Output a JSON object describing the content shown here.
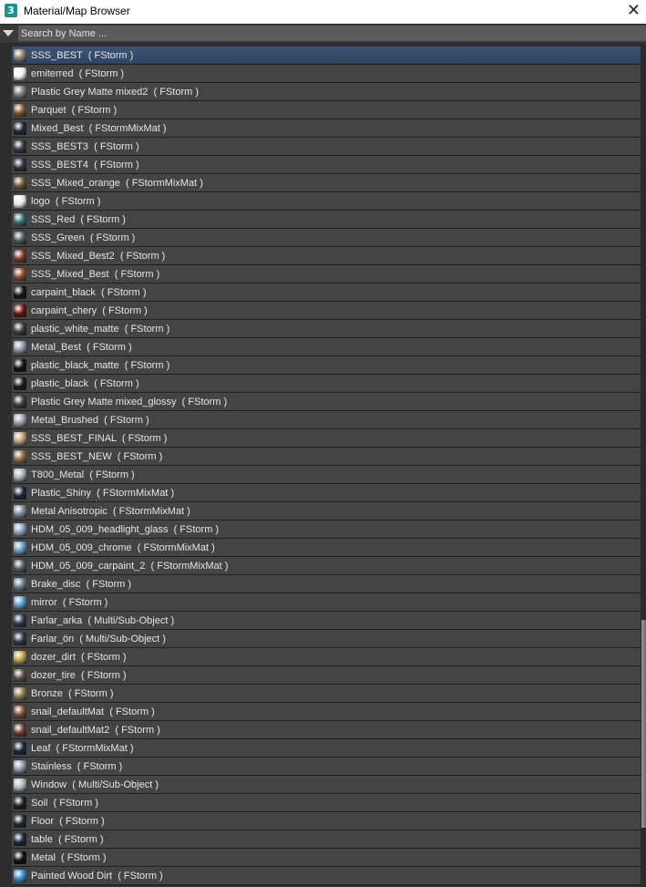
{
  "window": {
    "title": "Material/Map Browser",
    "app_icon": "3",
    "close_icon": "close-icon"
  },
  "search": {
    "placeholder": "Search by Name ..."
  },
  "scrollbar": {
    "position_fraction": 0.68
  },
  "materials": [
    {
      "name": "SSS_BEST",
      "type": "FStorm",
      "color": "#8a7a68",
      "selected": true
    },
    {
      "name": "emiterred",
      "type": "FStorm",
      "color": "#f4f0ee"
    },
    {
      "name": "Plastic Grey Matte mixed2",
      "type": "FStorm",
      "color": "#7a7a7a"
    },
    {
      "name": "Parquet",
      "type": "FStorm",
      "color": "#7a5632"
    },
    {
      "name": "Mixed_Best",
      "type": "FStormMixMat",
      "color": "#202838"
    },
    {
      "name": "SSS_BEST3",
      "type": "FStorm",
      "color": "#303644"
    },
    {
      "name": "SSS_BEST4",
      "type": "FStorm",
      "color": "#2c3240"
    },
    {
      "name": "SSS_Mixed_orange",
      "type": "FStormMixMat",
      "color": "#6a5438"
    },
    {
      "name": "logo",
      "type": "FStorm",
      "color": "#e8e8e8"
    },
    {
      "name": "SSS_Red",
      "type": "FStorm",
      "color": "#2e6a6a"
    },
    {
      "name": "SSS_Green",
      "type": "FStorm",
      "color": "#4a5a5a"
    },
    {
      "name": "SSS_Mixed_Best2",
      "type": "FStorm",
      "color": "#7a3a28"
    },
    {
      "name": "SSS_Mixed_Best",
      "type": "FStorm",
      "color": "#8a4a30"
    },
    {
      "name": "carpaint_black",
      "type": "FStorm",
      "color": "#141414"
    },
    {
      "name": "carpaint_chery",
      "type": "FStorm",
      "color": "#6a1414"
    },
    {
      "name": "plastic_white_matte",
      "type": "FStorm",
      "color": "#3a3a3a"
    },
    {
      "name": "Metal_Best",
      "type": "FStorm",
      "color": "#8a9aaa"
    },
    {
      "name": "plastic_black_matte",
      "type": "FStorm",
      "color": "#121212"
    },
    {
      "name": "plastic_black",
      "type": "FStorm",
      "color": "#1a1a1a"
    },
    {
      "name": "Plastic Grey Matte mixed_glossy",
      "type": "FStorm",
      "color": "#3a3a3a"
    },
    {
      "name": "Metal_Brushed",
      "type": "FStorm",
      "color": "#9aa0aa"
    },
    {
      "name": "SSS_BEST_FINAL",
      "type": "FStorm",
      "color": "#c0a080"
    },
    {
      "name": "SSS_BEST_NEW",
      "type": "FStorm",
      "color": "#8a6a48"
    },
    {
      "name": "T800_Metal",
      "type": "FStorm",
      "color": "#aab0b8"
    },
    {
      "name": "Plastic_Shiny",
      "type": "FStormMixMat",
      "color": "#1a2a3a"
    },
    {
      "name": "Metal Anisotropic",
      "type": "FStormMixMat",
      "color": "#7a8a9a"
    },
    {
      "name": "HDM_05_009_headlight_glass",
      "type": "FStorm",
      "color": "#8aa0b8"
    },
    {
      "name": "HDM_05_009_chrome",
      "type": "FStormMixMat",
      "color": "#6a9ac0"
    },
    {
      "name": "HDM_05_009_carpaint_2",
      "type": "FStormMixMat",
      "color": "#505860"
    },
    {
      "name": "Brake_disc",
      "type": "FStorm",
      "color": "#6a7a8a"
    },
    {
      "name": "mirror",
      "type": "FStorm",
      "color": "#5a9ac8"
    },
    {
      "name": "Farlar_arka",
      "type": "Multi/Sub-Object",
      "color": "#283848"
    },
    {
      "name": "Farlar_ön",
      "type": "Multi/Sub-Object",
      "color": "#283848"
    },
    {
      "name": "dozer_dirt",
      "type": "FStorm",
      "color": "#c0a050"
    },
    {
      "name": "dozer_tire",
      "type": "FStorm",
      "color": "#5a5040"
    },
    {
      "name": "Bronze",
      "type": "FStorm",
      "color": "#8a7a50"
    },
    {
      "name": "snail_defaultMat",
      "type": "FStorm",
      "color": "#7a4a3a"
    },
    {
      "name": "snail_defaultMat2",
      "type": "FStorm",
      "color": "#6a3a30"
    },
    {
      "name": "Leaf",
      "type": "FStormMixMat",
      "color": "#182838"
    },
    {
      "name": "Stainless",
      "type": "FStorm",
      "color": "#8a9aaa"
    },
    {
      "name": "Window",
      "type": "Multi/Sub-Object",
      "color": "#b0b8c0"
    },
    {
      "name": "Soil",
      "type": "FStorm",
      "color": "#1a2028"
    },
    {
      "name": "Floor",
      "type": "FStorm",
      "color": "#202830"
    },
    {
      "name": "table",
      "type": "FStorm",
      "color": "#182838"
    },
    {
      "name": "Metal",
      "type": "FStorm",
      "color": "#101010"
    },
    {
      "name": "Painted Wood Dirt",
      "type": "FStorm",
      "color": "#3a8ad0"
    }
  ]
}
